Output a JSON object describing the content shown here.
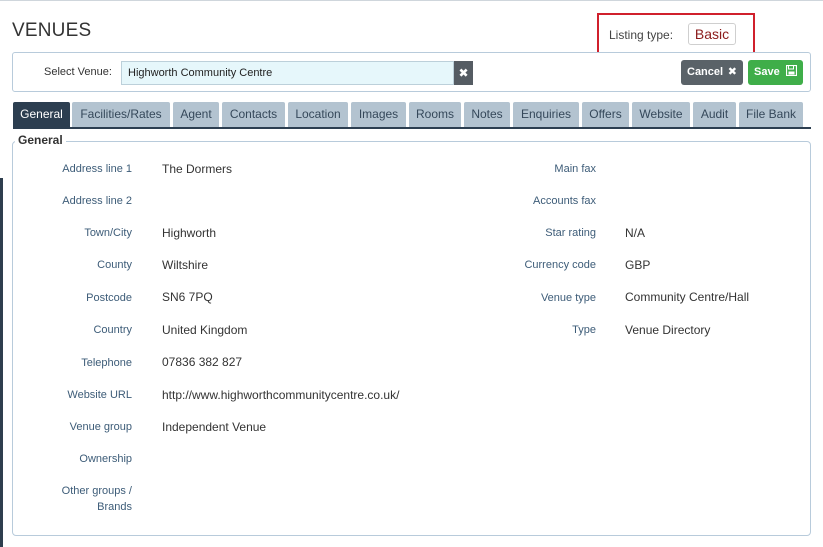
{
  "page": {
    "title": "VENUES"
  },
  "listing": {
    "label": "Listing type:",
    "value": "Basic"
  },
  "venue_select": {
    "label": "Select Venue:",
    "value": "Highworth Community Centre",
    "clear_icon": "close-icon"
  },
  "actions": {
    "cancel_label": "Cancel",
    "cancel_icon": "close-icon",
    "save_label": "Save",
    "save_icon": "floppy-disk-icon"
  },
  "tabs": [
    {
      "label": "General",
      "active": true
    },
    {
      "label": "Facilities/Rates"
    },
    {
      "label": "Agent"
    },
    {
      "label": "Contacts"
    },
    {
      "label": "Location"
    },
    {
      "label": "Images"
    },
    {
      "label": "Rooms"
    },
    {
      "label": "Notes"
    },
    {
      "label": "Enquiries"
    },
    {
      "label": "Offers"
    },
    {
      "label": "Website"
    },
    {
      "label": "Audit"
    },
    {
      "label": "File Bank"
    }
  ],
  "general": {
    "legend": "General",
    "left_fields": [
      {
        "label": "Address line 1",
        "value": "The Dormers"
      },
      {
        "label": "Address line 2",
        "value": ""
      },
      {
        "label": "Town/City",
        "value": "Highworth"
      },
      {
        "label": "County",
        "value": "Wiltshire"
      },
      {
        "label": "Postcode",
        "value": "SN6 7PQ"
      },
      {
        "label": "Country",
        "value": "United Kingdom"
      },
      {
        "label": "Telephone",
        "value": "07836 382 827"
      },
      {
        "label": "Website URL",
        "value": "http://www.highworthcommunitycentre.co.uk/"
      },
      {
        "label": "Venue group",
        "value": "Independent Venue"
      },
      {
        "label": "Ownership",
        "value": ""
      },
      {
        "label": "Other groups /",
        "label2": "Brands",
        "value": ""
      }
    ],
    "right_fields": [
      {
        "label": "Main fax",
        "value": ""
      },
      {
        "label": "Accounts fax",
        "value": ""
      },
      {
        "label": "Star rating",
        "value": "N/A"
      },
      {
        "label": "Currency code",
        "value": "GBP"
      },
      {
        "label": "Venue type",
        "value": "Community Centre/Hall"
      },
      {
        "label": "Type",
        "value": "Venue Directory"
      }
    ]
  },
  "colors": {
    "accent_dark": "#2c3e50",
    "tab_inactive": "#b3c3d0",
    "save_green": "#3fae49",
    "highlight_red": "#d0202c"
  }
}
